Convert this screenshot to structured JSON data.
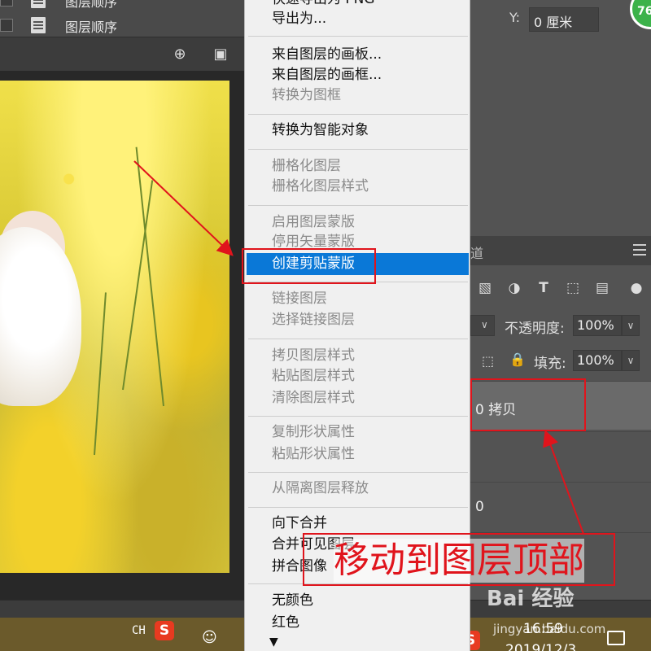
{
  "top_left_panel": {
    "rows": [
      {
        "label": "图层顺序"
      },
      {
        "label": "图层顺序"
      }
    ]
  },
  "right_top": {
    "y_label": "Y:",
    "y_value": "0 厘米",
    "badge": "76"
  },
  "layers_panel": {
    "tab_label": "道",
    "opacity_label": "不透明度:",
    "opacity_value": "100%",
    "fill_label": "填充:",
    "fill_value": "100%",
    "layers": [
      {
        "name": "0 拷贝"
      },
      {
        "name": ""
      },
      {
        "name": "0"
      }
    ]
  },
  "context_menu": {
    "items": [
      {
        "label": "快速导出为 PNG",
        "enabled": true
      },
      {
        "label": "导出为...",
        "enabled": true
      },
      {
        "label": "来自图层的画板...",
        "enabled": true
      },
      {
        "label": "来自图层的画框...",
        "enabled": true
      },
      {
        "label": "转换为图框",
        "enabled": false
      },
      {
        "label": "转换为智能对象",
        "enabled": true
      },
      {
        "label": "栅格化图层",
        "enabled": false
      },
      {
        "label": "栅格化图层样式",
        "enabled": false
      },
      {
        "label": "启用图层蒙版",
        "enabled": false
      },
      {
        "label": "停用矢量蒙版",
        "enabled": false
      },
      {
        "label": "创建剪贴蒙版",
        "enabled": true,
        "highlighted": true
      },
      {
        "label": "链接图层",
        "enabled": false
      },
      {
        "label": "选择链接图层",
        "enabled": false
      },
      {
        "label": "拷贝图层样式",
        "enabled": false
      },
      {
        "label": "粘贴图层样式",
        "enabled": false
      },
      {
        "label": "清除图层样式",
        "enabled": false
      },
      {
        "label": "复制形状属性",
        "enabled": false
      },
      {
        "label": "粘贴形状属性",
        "enabled": false
      },
      {
        "label": "从隔离图层释放",
        "enabled": false
      },
      {
        "label": "向下合并",
        "enabled": true
      },
      {
        "label": "合并可见图层",
        "enabled": true
      },
      {
        "label": "拼合图像",
        "enabled": true
      },
      {
        "label": "无颜色",
        "enabled": true
      },
      {
        "label": "红色",
        "enabled": true
      }
    ],
    "more_arrow": "▼"
  },
  "annotation": {
    "text": "移动到图层顶部",
    "color": "#e0141c"
  },
  "taskbar": {
    "ime": "CH",
    "sogou": "S",
    "time": "16:59",
    "date": "2019/12/3"
  },
  "watermark": {
    "brand": "Bai 经验",
    "url": "jingyan.baidu.com"
  },
  "colors": {
    "highlight": "#0a78d7",
    "panel_bg": "#535353",
    "menu_bg": "#f0f0f0",
    "annotation_red": "#e0141c"
  }
}
